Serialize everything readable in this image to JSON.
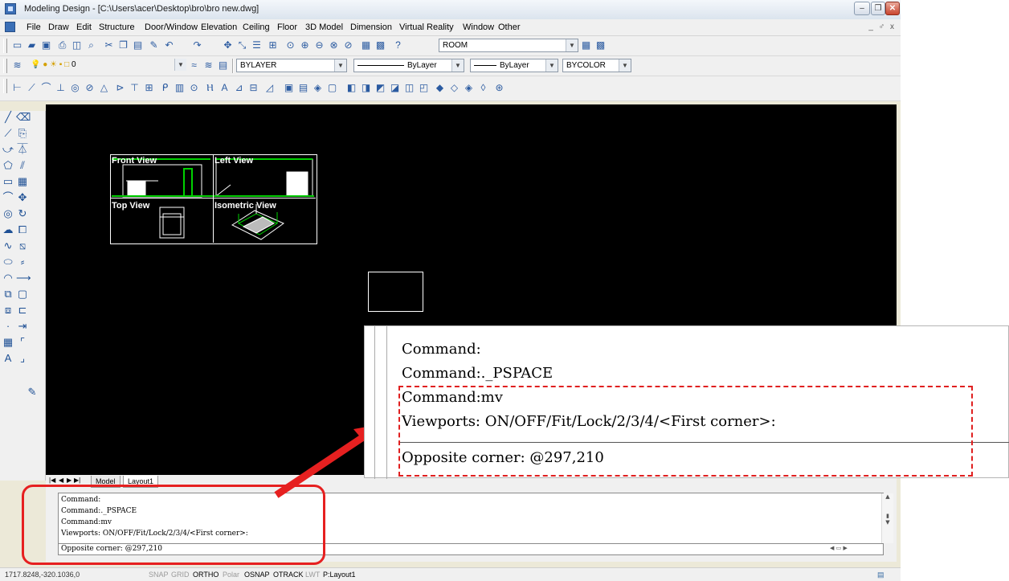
{
  "window": {
    "title": "Modeling Design - [C:\\Users\\acer\\Desktop\\bro\\bro new.dwg]",
    "minimize": "–",
    "maximize": "❐",
    "close": "✕"
  },
  "menu": {
    "items": [
      "File",
      "Draw",
      "Edit",
      "Structure",
      "Door/Window",
      "Elevation",
      "Ceiling",
      "Floor",
      "3D Model",
      "Dimension",
      "Virtual Reality",
      "Window",
      "Other"
    ],
    "mdi_buttons": "_ ♂ x"
  },
  "toolbar1": {
    "room_combo": "ROOM"
  },
  "toolbar2": {
    "layer_combo": "0",
    "color_combo": "BYLAYER",
    "linetype_combo": "ByLayer",
    "lineweight_combo": "ByLayer",
    "plotstyle_combo": "BYCOLOR"
  },
  "viewports": {
    "front": "Front View",
    "left": "Left View",
    "top": "Top View",
    "isometric": "Isometric View"
  },
  "tabs": {
    "model": "Model",
    "layout1": "Layout1"
  },
  "command": {
    "lines": [
      "Command:",
      "Command:._PSPACE",
      "Command:mv",
      "Viewports:  ON/OFF/Fit/Lock/2/3/4/<First corner>:"
    ],
    "input": "Opposite corner: @297,210"
  },
  "callout": {
    "lines": [
      "Command:",
      "Command:._PSPACE",
      "Command:mv",
      "Viewports:  ON/OFF/Fit/Lock/2/3/4/<First corner>:"
    ],
    "input": "Opposite corner: @297,210"
  },
  "status": {
    "coords": "1717.8248,-320.1036,0",
    "buttons": [
      {
        "label": "SNAP",
        "on": false
      },
      {
        "label": "GRID",
        "on": false
      },
      {
        "label": "ORTHO",
        "on": true
      },
      {
        "label": "Polar",
        "on": false
      },
      {
        "label": "OSNAP",
        "on": true
      },
      {
        "label": "OTRACK",
        "on": true
      },
      {
        "label": "LWT",
        "on": false
      },
      {
        "label": "P:Layout1",
        "on": true
      }
    ]
  },
  "colors": {
    "highlight_red": "#e62020",
    "canvas": "#000000",
    "geometry_green": "#00d000"
  }
}
